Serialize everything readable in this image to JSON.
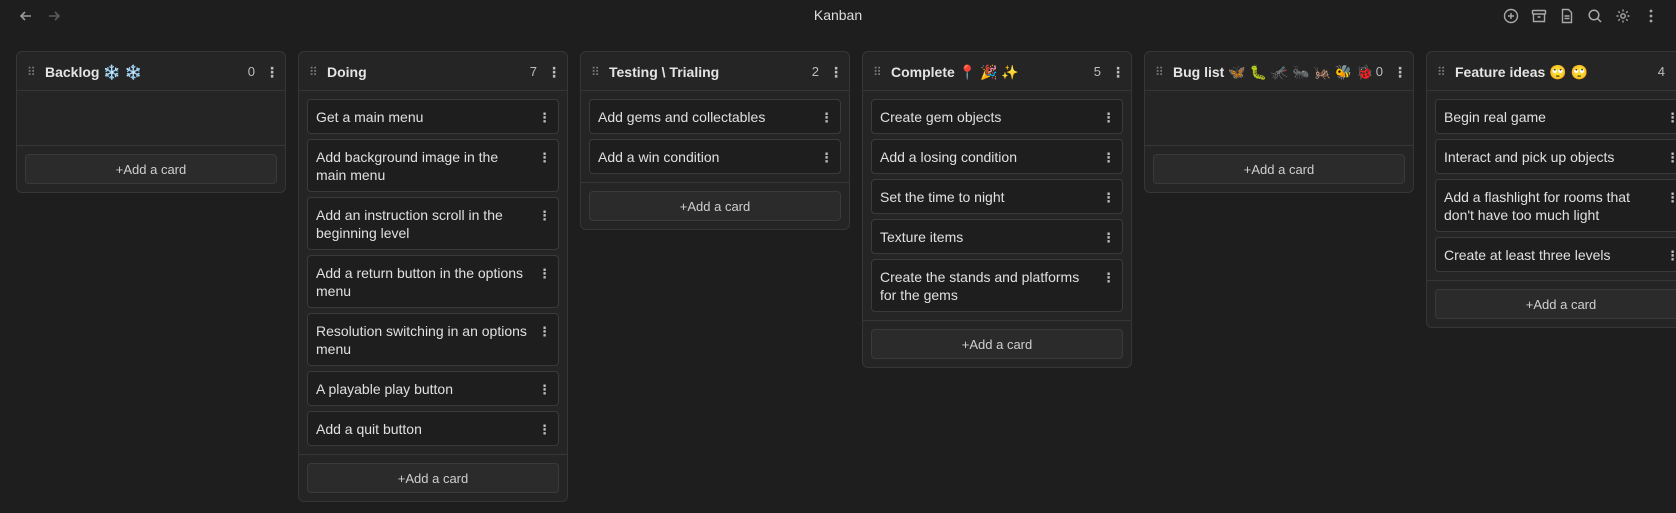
{
  "app": {
    "title": "Kanban"
  },
  "nav": {
    "back_icon": "arrow-left-icon",
    "forward_icon": "arrow-right-icon"
  },
  "toolbar": {
    "icons": [
      "plus-circle-icon",
      "archive-icon",
      "document-icon",
      "search-icon",
      "gear-icon",
      "more-vertical-icon"
    ]
  },
  "symbols": {
    "grip": "⠿",
    "kebab": "⋮"
  },
  "lanes": [
    {
      "title": "Backlog ❄️ ❄️",
      "count": "0",
      "cards": [],
      "add_label": "+Add a card"
    },
    {
      "title": "Doing",
      "count": "7",
      "cards": [
        "Get a main menu",
        "Add background image in the main menu",
        "Add an instruction scroll in the beginning level",
        "Add a return button in the options menu",
        "Resolution switching in an options menu",
        "A playable play button",
        "Add a quit button"
      ],
      "add_label": "+Add a card"
    },
    {
      "title": "Testing \\ Trialing",
      "count": "2",
      "cards": [
        "Add gems and collectables",
        "Add a win condition"
      ],
      "add_label": "+Add a card"
    },
    {
      "title": "Complete 📍 🎉 ✨",
      "count": "5",
      "cards": [
        "Create gem objects",
        "Add a losing condition",
        "Set the time to night",
        "Texture items",
        "Create the stands and platforms for the gems"
      ],
      "add_label": "+Add a card"
    },
    {
      "title": "Bug list 🦋 🐛 🦟 🐜 🦗 🐝 🐞",
      "count": "0",
      "cards": [],
      "add_label": "+Add a card"
    },
    {
      "title": "Feature ideas 🙄 🙄",
      "count": "4",
      "cards": [
        "Begin real game",
        "Interact and pick up objects",
        "Add a flashlight for rooms that don't have too much light",
        "Create at least three levels"
      ],
      "add_label": "+Add a card"
    }
  ]
}
